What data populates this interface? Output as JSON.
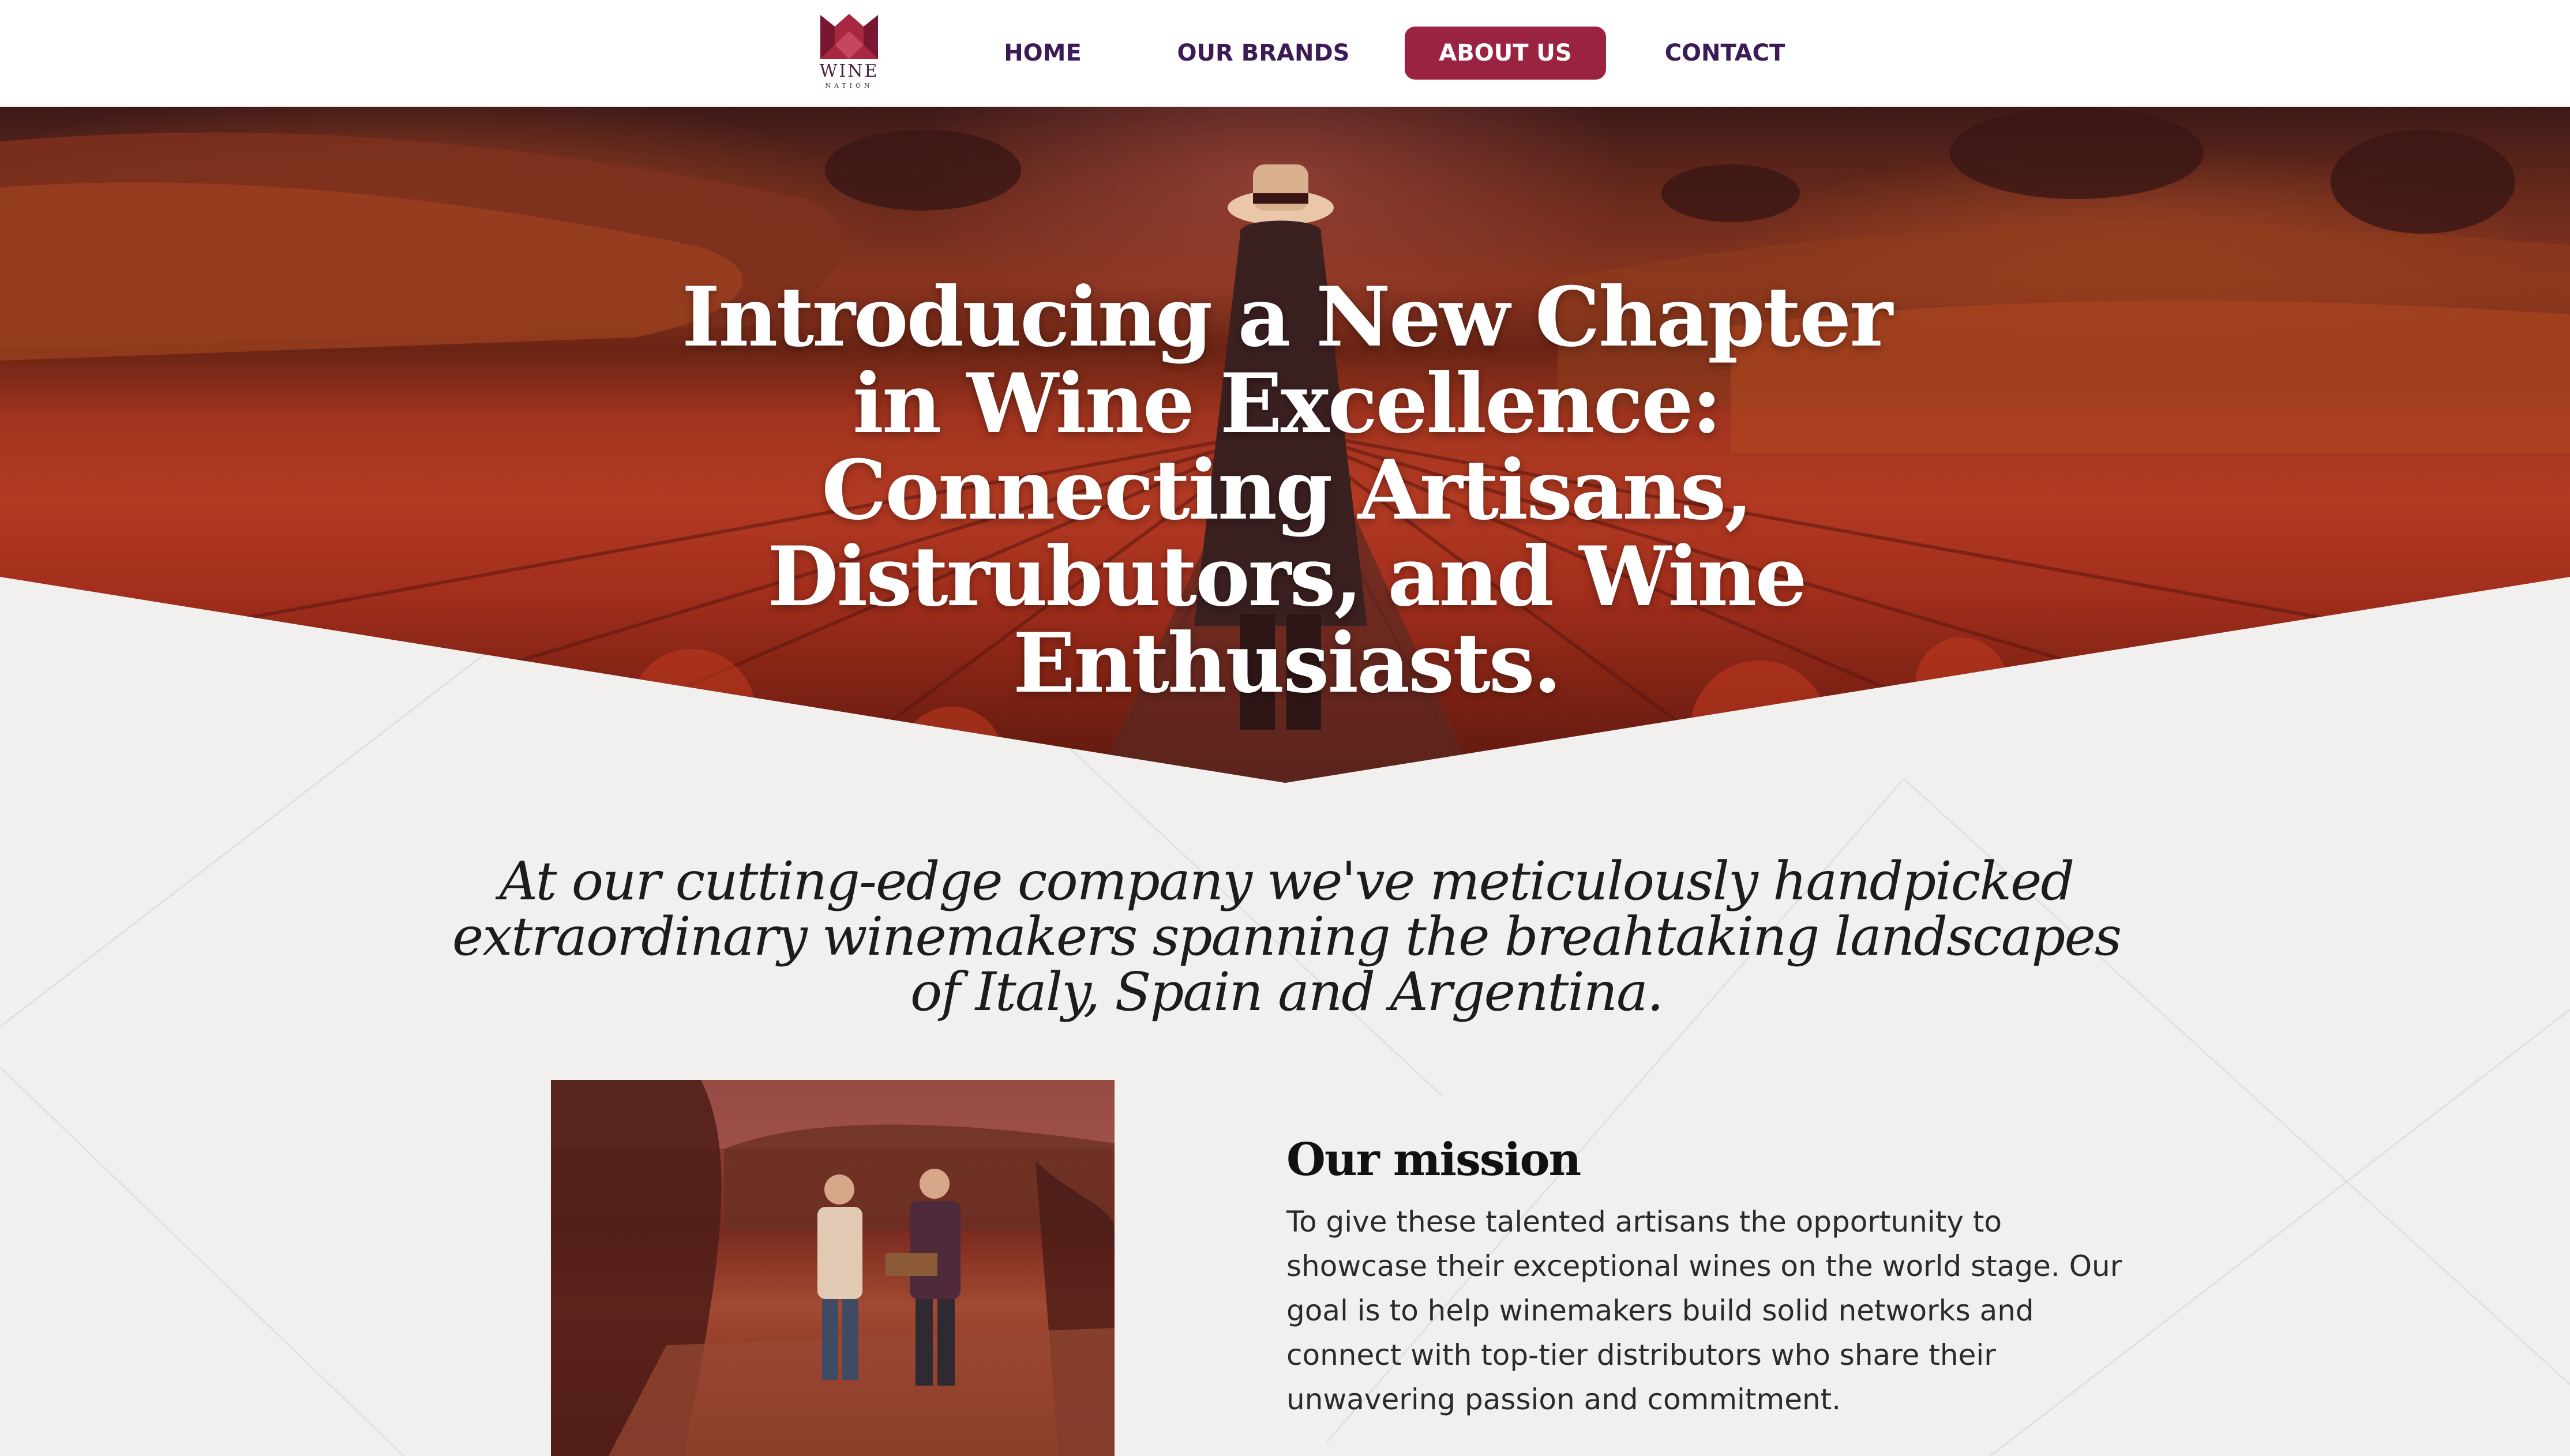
{
  "brand": {
    "logo_word": "WINE",
    "logo_sub": "NATION",
    "logo_color": "#a8283f"
  },
  "nav": {
    "items": [
      {
        "label": "HOME",
        "active": false
      },
      {
        "label": "OUR BRANDS",
        "active": false
      },
      {
        "label": "ABOUT US",
        "active": true
      },
      {
        "label": "CONTACT",
        "active": false
      }
    ],
    "active_color": "#9b2342",
    "text_color": "#3b1a55"
  },
  "hero": {
    "title": "Introducing a New Chapter in Wine Excellence: Connecting Artisans, Distrubutors, and Wine Enthusiasts.",
    "image": "vineyard-man-walking"
  },
  "intro": {
    "text": "At our cutting-edge company we've meticulously handpicked extraordinary winemakers spanning the breahtaking landscapes of Italy, Spain and Argentina."
  },
  "mission": {
    "title": "Our mission",
    "body": "To give these talented artisans the opportunity to showcase their exceptional wines on the world stage. Our goal is to help winemakers build solid networks and connect with top-tier distributors who share their unwavering passion and commitment.",
    "image": "two-winemakers-in-vineyard"
  },
  "colors": {
    "background": "#f2f0ef",
    "header": "#ffffff",
    "accent": "#9b2342"
  }
}
